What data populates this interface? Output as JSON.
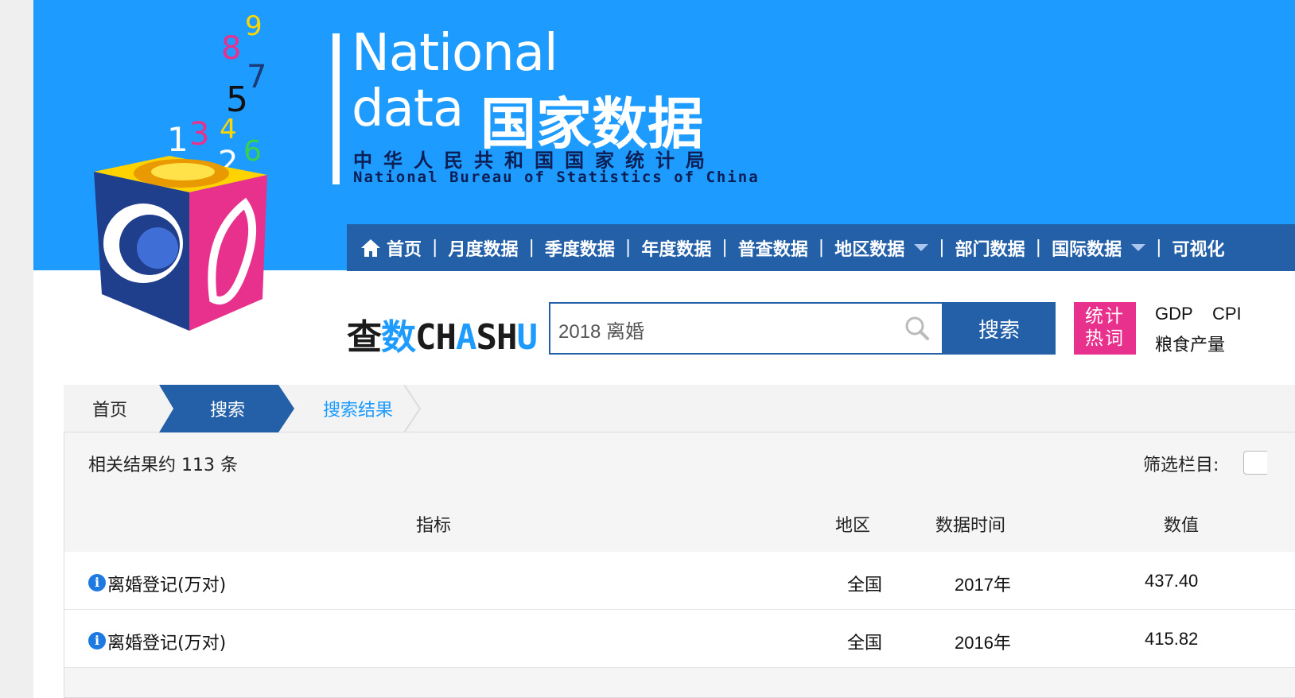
{
  "brand": {
    "en_line1": "National",
    "en_line2": "data",
    "cn_name": "国家数据",
    "org_cn": "中华人民共和国国家统计局",
    "org_en": "National Bureau of Statistics of China",
    "cube_digits": [
      "9",
      "8",
      "7",
      "5",
      "1",
      "3",
      "4",
      "2",
      "6"
    ]
  },
  "nav": {
    "items": [
      {
        "label": "首页",
        "icon": "home-icon"
      },
      {
        "label": "月度数据"
      },
      {
        "label": "季度数据"
      },
      {
        "label": "年度数据"
      },
      {
        "label": "普查数据"
      },
      {
        "label": "地区数据",
        "dropdown": true
      },
      {
        "label": "部门数据"
      },
      {
        "label": "国际数据",
        "dropdown": true
      },
      {
        "label": "可视化"
      }
    ],
    "separator": "|"
  },
  "search": {
    "logo_part1": "查",
    "logo_part2": "数",
    "logo_part3": "CH",
    "logo_part4": "A",
    "logo_part5": "SH",
    "logo_part6": "U",
    "value": "2018 离婚",
    "button_label": "搜索",
    "hot_label_line1": "统计",
    "hot_label_line2": "热词",
    "hot_words": [
      "GDP",
      "CPI",
      "粮食产量"
    ]
  },
  "breadcrumb": {
    "home": "首页",
    "search": "搜索",
    "result": "搜索结果"
  },
  "results": {
    "count_text": "相关结果约 113 条",
    "filter_label": "筛选栏目:"
  },
  "table": {
    "headers": {
      "indicator": "指标",
      "region": "地区",
      "time": "数据时间",
      "value": "数值"
    },
    "rows": [
      {
        "indicator": "离婚登记(万对)",
        "region": "全国",
        "time": "2017年",
        "value": "437.40"
      },
      {
        "indicator": "离婚登记(万对)",
        "region": "全国",
        "time": "2016年",
        "value": "415.82"
      }
    ]
  },
  "colors": {
    "header_blue": "#1e9bff",
    "nav_blue": "#2460a8",
    "hot_pink": "#e8318c"
  }
}
